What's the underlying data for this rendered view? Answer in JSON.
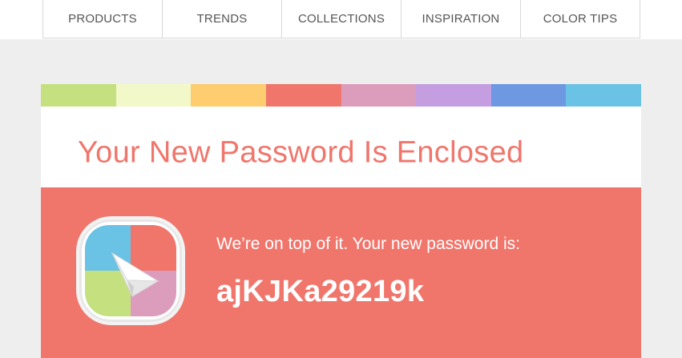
{
  "nav": {
    "items": [
      {
        "label": "PRODUCTS"
      },
      {
        "label": "TRENDS"
      },
      {
        "label": "COLLECTIONS"
      },
      {
        "label": "INSPIRATION"
      },
      {
        "label": "COLOR TIPS"
      }
    ]
  },
  "stripe_colors": [
    "#c5e07f",
    "#f3f8c8",
    "#fdcd70",
    "#f0766c",
    "#dc9dbd",
    "#c49ee0",
    "#6e99e2",
    "#6ac2e4"
  ],
  "email": {
    "title": "Your New Password Is Enclosed",
    "message": "We’re on top of it. Your new password is:",
    "password": "ajKJKa29219k"
  },
  "icon": {
    "name": "paper-plane-app-icon",
    "colors": {
      "top_left": "#6ac2e4",
      "top_right": "#f0766c",
      "bottom_left": "#c5e07f",
      "bottom_right": "#dc9dbd"
    }
  },
  "colors": {
    "accent": "#f0766c",
    "page_background": "#eeeeee"
  }
}
